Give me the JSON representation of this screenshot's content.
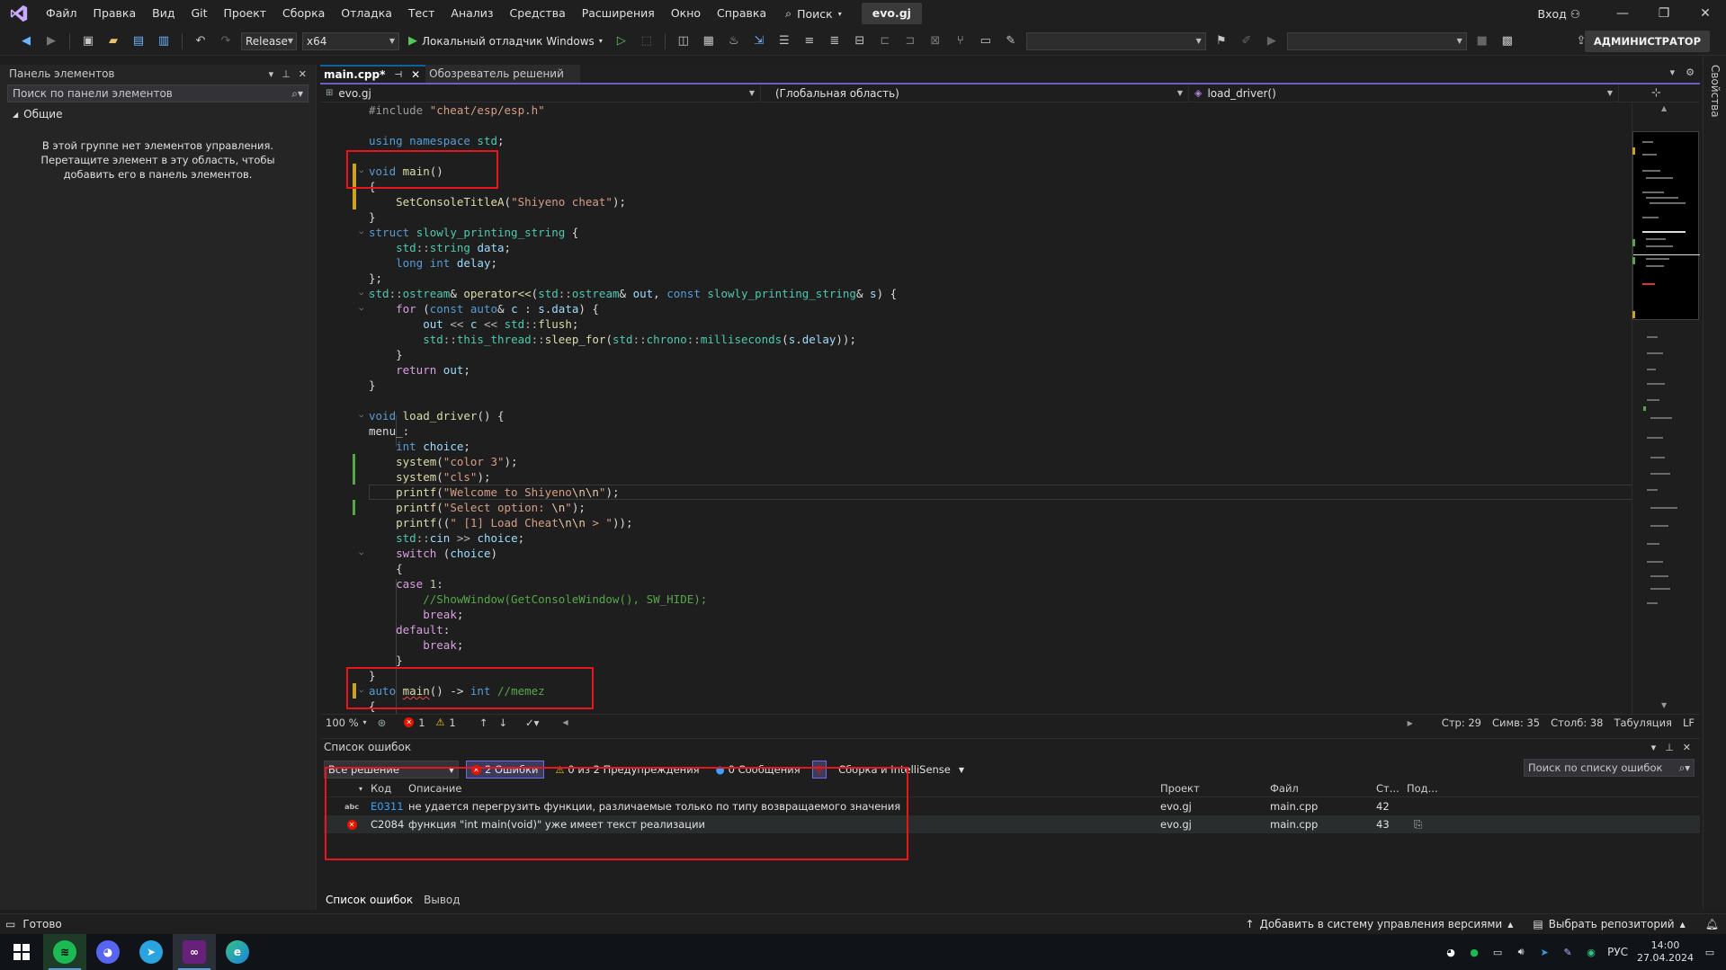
{
  "menubar": {
    "items": [
      "Файл",
      "Правка",
      "Вид",
      "Git",
      "Проект",
      "Сборка",
      "Отладка",
      "Тест",
      "Анализ",
      "Средства",
      "Расширения",
      "Окно",
      "Справка"
    ],
    "search_label": "Поиск",
    "solution_name": "evo.gj",
    "signin_label": "Вход"
  },
  "toolbar": {
    "configuration": "Release",
    "platform": "x64",
    "debugger_label": "Локальный отладчик Windows",
    "admin_badge": "АДМИНИСТРАТОР"
  },
  "toolbox": {
    "title": "Панель элементов",
    "search_placeholder": "Поиск по панели элементов",
    "group_name": "Общие",
    "empty_message": "В этой группе нет элементов управления. Перетащите элемент в эту область, чтобы добавить его в панель элементов."
  },
  "tabs": {
    "active": "main.cpp*",
    "inactive": "Обозреватель решений"
  },
  "navbar": {
    "project": "evo.gj",
    "scope": "(Глобальная область)",
    "member": "load_driver()"
  },
  "editor_status": {
    "zoom": "100 %",
    "errors": "1",
    "warnings": "1",
    "line": "Стр: 29",
    "char": "Симв: 35",
    "col": "Столб: 38",
    "indent": "Табуляция",
    "eol": "LF"
  },
  "error_list": {
    "title": "Список ошибок",
    "scope_filter": "Все решение",
    "errors_btn": "2 Ошибки",
    "warnings_btn": "0 из 2 Предупреждения",
    "messages_btn": "0 Сообщения",
    "source_filter": "Сборка и IntelliSense",
    "search_placeholder": "Поиск по списку ошибок",
    "columns": {
      "code": "Код",
      "description": "Описание",
      "project": "Проект",
      "file": "Файл",
      "line": "Ст...",
      "suppression": "Под..."
    },
    "rows": [
      {
        "code": "E0311",
        "description": "не удается перегрузить функции, различаемые только по типу возвращаемого значения",
        "project": "evo.gj",
        "file": "main.cpp",
        "line": "42"
      },
      {
        "code": "C2084",
        "description": "функция \"int main(void)\" уже имеет текст реализации",
        "project": "evo.gj",
        "file": "main.cpp",
        "line": "43"
      }
    ]
  },
  "bottom_tabs": [
    "Список ошибок",
    "Вывод"
  ],
  "props_label": "Свойства",
  "statusbar": {
    "ready": "Готово",
    "source_control": "Добавить в систему управления версиями",
    "repo": "Выбрать репозиторий"
  },
  "taskbar": {
    "lang": "РУС",
    "time": "14:00",
    "date": "27.04.2024"
  },
  "colors": {
    "accent_purple": "#6c5ec4",
    "error_red": "#e51400",
    "annotation_red": "#e8141e",
    "keyword_blue": "#569cd6",
    "string_brown": "#d69d85"
  }
}
